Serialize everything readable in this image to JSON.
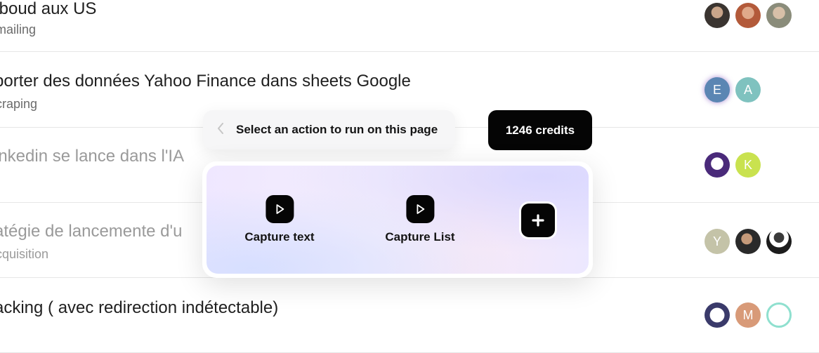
{
  "rows": [
    {
      "title": "tboud aux US",
      "subtitle": "mailing",
      "avatars": [
        "photo",
        "photo",
        "photo"
      ]
    },
    {
      "title": "porter des données Yahoo Finance dans sheets Google",
      "subtitle": "craping",
      "avatars": [
        "E",
        "A"
      ]
    },
    {
      "title": "inkedin se lance dans l'IA",
      "subtitle": "",
      "avatars": [
        "illustration",
        "K"
      ]
    },
    {
      "title": "atégie de lancemente d'u",
      "subtitle": "cquisition",
      "avatars": [
        "Y",
        "photo",
        "photo"
      ]
    },
    {
      "title": "acking ( avec redirection indétectable)",
      "subtitle": "",
      "avatars": [
        "illustration",
        "M",
        "photo"
      ]
    }
  ],
  "avatar_letters": {
    "r2a": "E",
    "r2b": "A",
    "r3b": "K",
    "r4a": "Y",
    "r5b": "M"
  },
  "action_bar": {
    "back_icon": "chevron-left-icon",
    "label": "Select an action to run on this page"
  },
  "credits": {
    "label": "1246 credits"
  },
  "actions": [
    {
      "label": "Capture text",
      "icon": "play-icon"
    },
    {
      "label": "Capture List",
      "icon": "play-icon"
    }
  ],
  "add_action": {
    "icon": "plus-icon"
  },
  "colors": {
    "dark": "#050505",
    "avatar_E": "#5b86b3",
    "avatar_A": "#7fc2bf",
    "avatar_K": "#c9e24f",
    "avatar_Y": "#c4c3a8",
    "avatar_M": "#d89a78"
  }
}
